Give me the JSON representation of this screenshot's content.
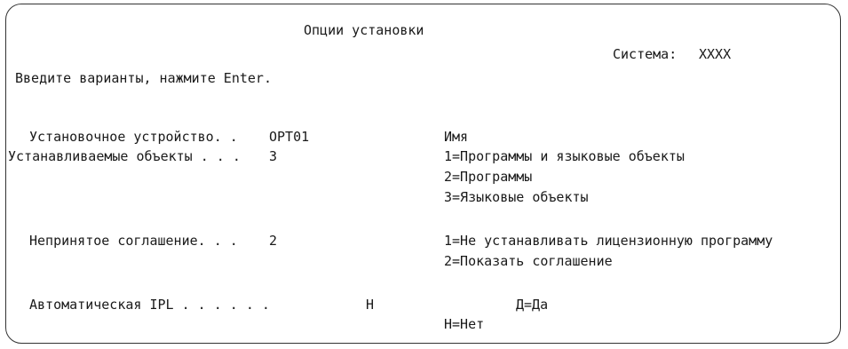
{
  "screen": {
    "title": "Опции установки",
    "system_label": "Система:",
    "system_value": "XXXX",
    "instruction": "Введите варианты, нажмите Enter."
  },
  "fields": {
    "install_device": {
      "label": "Установочное устройство. .",
      "value": "OPT01",
      "hint": "Имя"
    },
    "objects_to_install": {
      "label": "Устанавливаемые объекты . . .",
      "value": "3",
      "options": [
        "1=Программы и языковые объекты",
        "2=Программы",
        "3=Языковые объекты"
      ]
    },
    "unaccepted_agreement": {
      "label": "Непринятое соглашение. . .",
      "value": "2",
      "options": [
        "1=Не устанавливать лицензионную программу",
        "2=Показать соглашение"
      ]
    },
    "automatic_ipl": {
      "label": "Автоматическая IPL . . . . . .",
      "value": "Н",
      "options": [
        "Д=Да",
        "Н=Нет"
      ]
    }
  }
}
